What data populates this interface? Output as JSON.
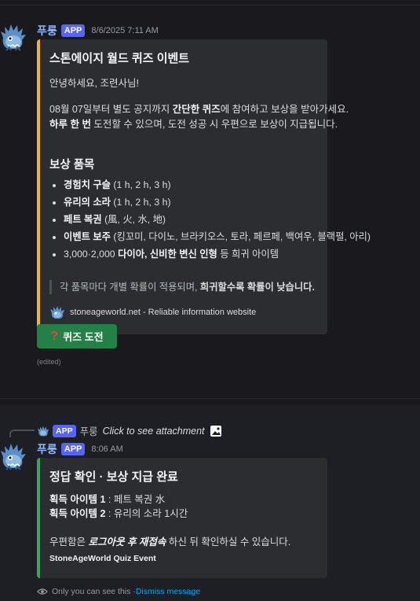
{
  "message1": {
    "username": "푸룽",
    "badge": "APP",
    "timestamp": "8/6/2025 7:11 AM",
    "embed": {
      "title": "스톤에이지 월드 퀴즈 이벤트",
      "greeting": "안녕하세요, 조련사님!",
      "line1_pre": "08월 07일부터 별도 공지까지 ",
      "line1_bold": "간단한 퀴즈",
      "line1_post": "에 참여하고 보상을 받아가세요.",
      "line2_bold": "하루 한 번",
      "line2_post": " 도전할 수 있으며, 도전 성공 시 우편으로 보상이 지급됩니다.",
      "rewards_heading": "보상 품목",
      "rewards": [
        {
          "bold": "경험치 구슬",
          "rest": " (1 h, 2 h, 3 h)"
        },
        {
          "bold": "유리의 소라",
          "rest": " (1 h, 2 h, 3 h)"
        },
        {
          "bold": "페트 복권",
          "rest": " (風, 火, 水, 地)"
        },
        {
          "bold": "이벤트 보주",
          "rest": " (킹꼬미, 다이노, 브라키오스, 토라, 페르페, 백여우, 블랙펄, 아리)"
        },
        {
          "pre": "3,000·2,000 ",
          "bold": "다이아, 신비한 변신 인형",
          "rest": " 등 희귀 아이템"
        }
      ],
      "quote_pre": "각 품목마다 개별 확률이 적용되며, ",
      "quote_bold": "희귀할수록 확률이 낮습니다.",
      "footer": "stoneageworld.net - Reliable information website"
    },
    "button_label": "퀴즈 도전",
    "edited": "(edited)"
  },
  "message2": {
    "reply": {
      "badge": "APP",
      "username": "푸룽",
      "text": "Click to see attachment"
    },
    "username": "푸룽",
    "badge": "APP",
    "timestamp": "8:06 AM",
    "embed": {
      "title": "정답 확인 · 보상 지급 완료",
      "item1_bold": "획득 아이템 1",
      "item1_rest": " : 페트 복권 水",
      "item2_bold": "획득 아이템 2",
      "item2_rest": " : 유리의 소라 1시간",
      "notice_pre": "우편함은 ",
      "notice_em": "로그아웃 후 재접속",
      "notice_post": " 하신 뒤 확인하실 수 있습니다.",
      "footer": "StoneAgeWorld Quiz Event"
    },
    "ephemeral_text": "Only you can see this · ",
    "dismiss_label": "Dismiss message"
  },
  "colors": {
    "embed1_accent": "#f0b232",
    "embed2_accent": "#3ba55d",
    "button": "#248046",
    "badge": "#5865f2",
    "link": "#00a8fc"
  }
}
